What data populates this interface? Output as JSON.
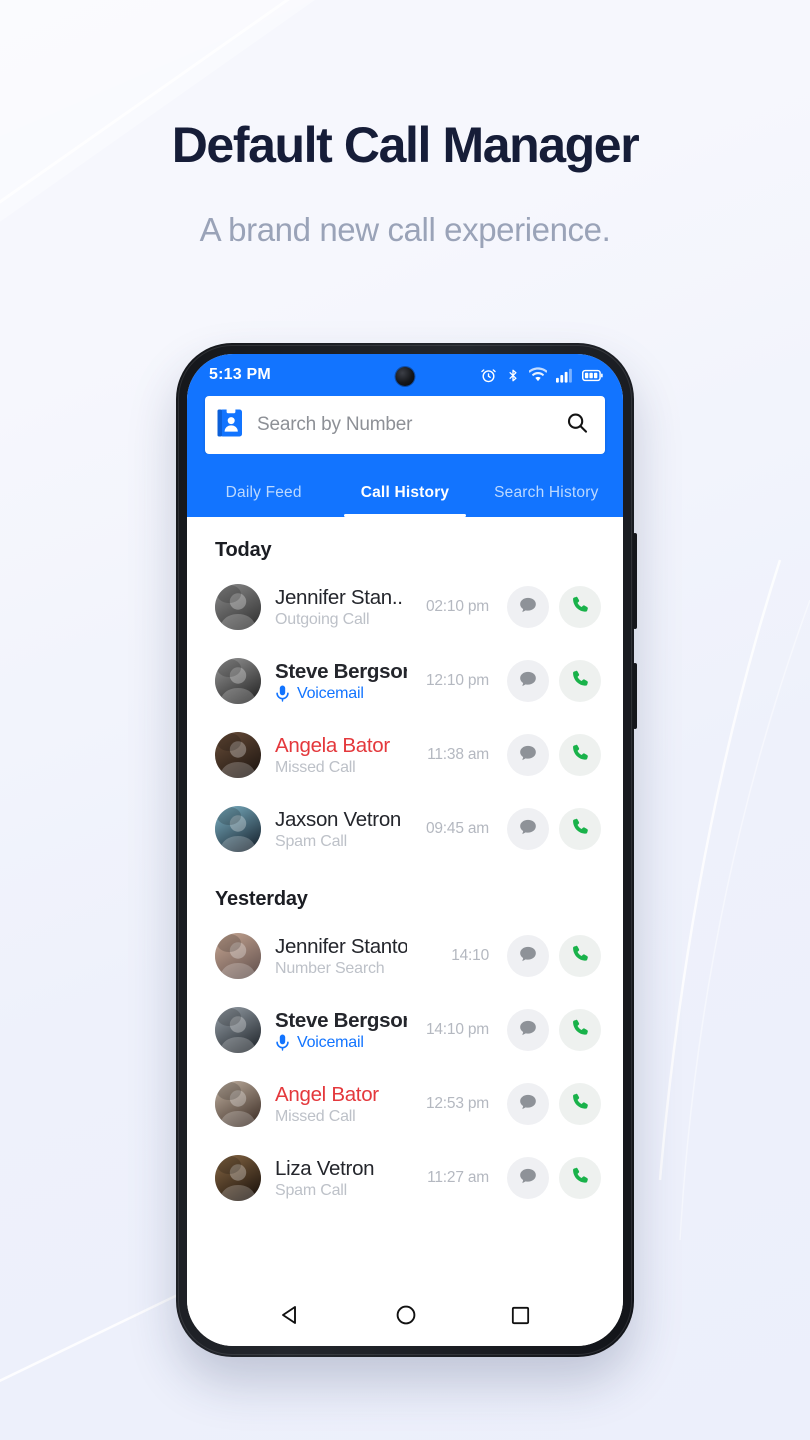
{
  "hero": {
    "title": "Default Call Manager",
    "subtitle": "A brand new call experience.",
    "title_color": "#161d38",
    "subtitle_color": "#9aa3b8"
  },
  "theme": {
    "accent_blue": "#1274ff",
    "missed_red": "#e4383c",
    "call_green": "#19b24a",
    "page_background": "#f2f4fc"
  },
  "phone": {
    "statusbar": {
      "time": "5:13 PM",
      "icons": [
        "alarm-icon",
        "bluetooth-icon",
        "wifi-icon",
        "cellular-signal-icon",
        "battery-icon"
      ],
      "camera": "front-camera-punch-hole"
    },
    "search": {
      "placeholder": "Search by Number",
      "value": "",
      "leading_icon": "contacts-book-icon",
      "trailing_icon": "search-icon"
    },
    "tabs": [
      {
        "label": "Daily Feed",
        "active": false
      },
      {
        "label": "Call History",
        "active": true
      },
      {
        "label": "Search History",
        "active": false
      }
    ],
    "sections": [
      {
        "title": "Today",
        "rows": [
          {
            "name": "Jennifer Stan..",
            "name_style": "normal",
            "subtitle": "Outgoing Call",
            "subtitle_style": "muted",
            "time": "02:10 pm",
            "avatar_hint": "woman-portrait-bw",
            "actions": [
              "message-icon",
              "call-icon"
            ]
          },
          {
            "name": "Steve Bergson",
            "name_style": "bold",
            "subtitle": "Voicemail",
            "subtitle_style": "voicemail",
            "time": "12:10 pm",
            "avatar_hint": "woman-portrait-bw-2",
            "actions": [
              "message-icon",
              "call-icon"
            ]
          },
          {
            "name": "Angela Bator",
            "name_style": "missed",
            "subtitle": "Missed Call",
            "subtitle_style": "muted",
            "time": "11:38 am",
            "avatar_hint": "woman-dark-hair",
            "actions": [
              "message-icon",
              "call-icon"
            ]
          },
          {
            "name": "Jaxson Vetron",
            "name_style": "normal",
            "subtitle": "Spam Call",
            "subtitle_style": "muted",
            "time": "09:45 am",
            "avatar_hint": "man-blue-background",
            "actions": [
              "message-icon",
              "call-icon"
            ]
          }
        ]
      },
      {
        "title": "Yesterday",
        "rows": [
          {
            "name": "Jennifer Stanton",
            "name_style": "normal",
            "subtitle": "Number Search",
            "subtitle_style": "muted",
            "time": "14:10",
            "avatar_hint": "woman-beach-portrait",
            "actions": [
              "message-icon",
              "call-icon"
            ]
          },
          {
            "name": "Steve Bergson",
            "name_style": "bold",
            "subtitle": "Voicemail",
            "subtitle_style": "voicemail",
            "time": "14:10 pm",
            "avatar_hint": "young-man-portrait",
            "actions": [
              "message-icon",
              "call-icon"
            ]
          },
          {
            "name": "Angel Bator",
            "name_style": "missed",
            "subtitle": "Missed Call",
            "subtitle_style": "muted",
            "time": "12:53 pm",
            "avatar_hint": "woman-hat-portrait",
            "actions": [
              "message-icon",
              "call-icon"
            ]
          },
          {
            "name": "Liza Vetron",
            "name_style": "normal",
            "subtitle": "Spam Call",
            "subtitle_style": "muted",
            "time": "11:27 am",
            "avatar_hint": "person-dark-portrait",
            "actions": [
              "message-icon",
              "call-icon"
            ]
          }
        ]
      }
    ],
    "navbar": [
      "back-triangle-icon",
      "home-circle-icon",
      "recents-square-icon"
    ]
  }
}
